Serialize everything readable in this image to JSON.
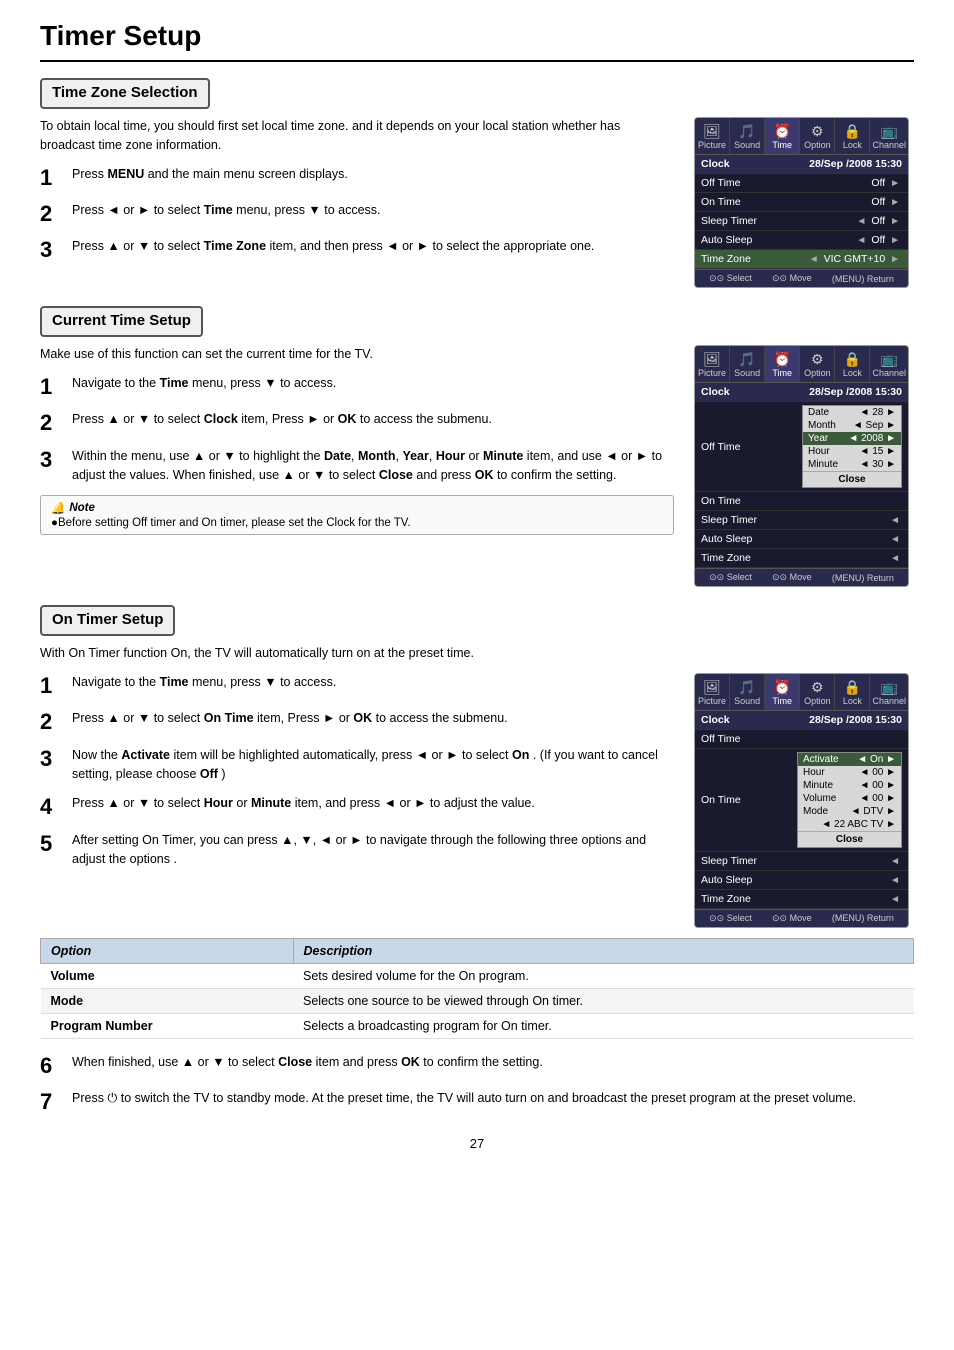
{
  "page": {
    "title": "Timer Setup",
    "page_number": "27"
  },
  "sections": {
    "timezone": {
      "heading": "Time Zone Selection",
      "description": "To obtain local time, you should first set local time zone. and it depends on your local station whether has broadcast time zone information.",
      "steps": [
        {
          "num": "1",
          "text": "Press <b>MENU</b> and the main menu screen displays."
        },
        {
          "num": "2",
          "text": "Press ◄ or ► to select <b>Time</b> menu,  press ▼  to access."
        },
        {
          "num": "3",
          "text": "Press ▲ or ▼  to select <b>Time Zone</b> item, and then press ◄ or ► to select the appropriate one."
        }
      ]
    },
    "current_time": {
      "heading": "Current Time Setup",
      "description": "Make use of this function can set the current time for the TV.",
      "steps": [
        {
          "num": "1",
          "text": "Navigate to the <b>Time</b> menu,  press ▼  to access."
        },
        {
          "num": "2",
          "text": "Press ▲ or ▼  to select <b>Clock</b> item, Press ► or  <b>OK</b> to access the submenu."
        },
        {
          "num": "3",
          "text": "Within the menu, use ▲ or ▼ to highlight the <b>Date</b>, <b>Month</b>, <b>Year</b>, <b>Hour</b> or <b>Minute</b> item, and use ◄ or ► to adjust the values. When finished, use ▲ or ▼  to select <b>Close</b> and press <b>OK</b> to confirm the setting."
        }
      ],
      "note": "Before setting Off timer and On timer, please set the Clock for the TV."
    },
    "on_timer": {
      "heading": "On Timer Setup",
      "description": "With On Timer function On, the TV will automatically turn on at the preset time.",
      "steps": [
        {
          "num": "1",
          "text": "Navigate to the <b>Time</b> menu,  press ▼  to access."
        },
        {
          "num": "2",
          "text": "Press ▲ or ▼  to select <b>On Time</b> item, Press ► or <b>OK</b> to access the submenu."
        },
        {
          "num": "3",
          "text": "Now the <b>Activate</b> item will be highlighted automatically, press ◄ or ► to select <b>On</b> . (If you want to cancel setting, please choose <b>Off</b> )"
        },
        {
          "num": "4",
          "text": "Press ▲ or ▼  to select <b>Hour</b> or <b>Minute</b> item, and press ◄ or ► to adjust the value."
        },
        {
          "num": "5",
          "text": "After setting On Timer, you can press ▲, ▼, ◄ or ► to navigate through the following three options and adjust the options ."
        }
      ],
      "options_table": {
        "headers": [
          "Option",
          "Description"
        ],
        "rows": [
          [
            "Volume",
            "Sets desired volume for the On program."
          ],
          [
            "Mode",
            "Selects one source to be viewed through On timer."
          ],
          [
            "Program Number",
            "Selects a broadcasting program for On timer."
          ]
        ]
      },
      "steps_after": [
        {
          "num": "6",
          "text": "When finished, use ▲ or ▼  to select <b>Close</b> item and press <b>OK</b> to confirm the setting."
        },
        {
          "num": "7",
          "text": "Press ⏻ to switch the TV to standby mode. At the preset time, the TV will auto turn on and broadcast the preset program at the preset volume."
        }
      ]
    }
  },
  "ui_menu_1": {
    "icons": [
      "Picture",
      "Sound",
      "Time",
      "Option",
      "Lock",
      "Channel"
    ],
    "active_icon": "Time",
    "rows": [
      {
        "label": "Clock",
        "value": "28/Sep /2008 15:30",
        "arrow_left": false,
        "arrow_right": false
      },
      {
        "label": "Off Time",
        "value": "Off",
        "arrow_left": false,
        "arrow_right": true
      },
      {
        "label": "On Time",
        "value": "Off",
        "arrow_left": false,
        "arrow_right": true
      },
      {
        "label": "Sleep Timer",
        "value": "Off",
        "arrow_left": true,
        "arrow_right": true
      },
      {
        "label": "Auto Sleep",
        "value": "Off",
        "arrow_left": true,
        "arrow_right": true
      },
      {
        "label": "Time Zone",
        "value": "VIC GMT+10",
        "arrow_left": true,
        "arrow_right": true
      }
    ],
    "footer": [
      "⊙⊙ Select",
      "⊙⊙ Move",
      "(MENU) Return"
    ]
  },
  "ui_menu_2": {
    "icons": [
      "Picture",
      "Sound",
      "Time",
      "Option",
      "Lock",
      "Channel"
    ],
    "active_icon": "Time",
    "rows": [
      {
        "label": "Clock",
        "value": "28/Sep /2008 15:30"
      },
      {
        "label": "Off Time",
        "value": ""
      },
      {
        "label": "On Time",
        "value": ""
      },
      {
        "label": "Sleep Timer",
        "value": "",
        "arrow_left": true
      },
      {
        "label": "Auto Sleep",
        "value": "",
        "arrow_left": true
      },
      {
        "label": "Time Zone",
        "value": "",
        "arrow_left": true
      }
    ],
    "popup": [
      {
        "label": "Date",
        "arrow_left": true,
        "value": "28",
        "arrow_right": true
      },
      {
        "label": "Month",
        "arrow_left": true,
        "value": "Sep",
        "arrow_right": true
      },
      {
        "label": "Year",
        "arrow_left": true,
        "value": "2008",
        "arrow_right": true
      },
      {
        "label": "Hour",
        "arrow_left": true,
        "value": "15",
        "arrow_right": true
      },
      {
        "label": "Minute",
        "arrow_left": true,
        "value": "30",
        "arrow_right": true
      }
    ],
    "popup_close": "Close",
    "footer": [
      "⊙⊙ Select",
      "⊙⊙ Move",
      "(MENU) Return"
    ]
  },
  "ui_menu_3": {
    "icons": [
      "Picture",
      "Sound",
      "Time",
      "Option",
      "Lock",
      "Channel"
    ],
    "active_icon": "Time",
    "rows": [
      {
        "label": "Clock",
        "value": "28/Sep /2008 15:30"
      },
      {
        "label": "Off Time",
        "value": ""
      },
      {
        "label": "On Time",
        "value": ""
      },
      {
        "label": "Sleep Timer",
        "value": "",
        "arrow_left": true
      },
      {
        "label": "Auto Sleep",
        "value": "",
        "arrow_left": true
      },
      {
        "label": "Time Zone",
        "value": "",
        "arrow_left": true
      }
    ],
    "popup": [
      {
        "label": "Activate",
        "arrow_left": true,
        "value": "On",
        "arrow_right": true
      },
      {
        "label": "Hour",
        "arrow_left": true,
        "value": "00",
        "arrow_right": true
      },
      {
        "label": "Minute",
        "arrow_left": true,
        "value": "00",
        "arrow_right": true
      },
      {
        "label": "Volume",
        "arrow_left": true,
        "value": "00",
        "arrow_right": true
      },
      {
        "label": "Mode",
        "arrow_left": true,
        "value": "DTV",
        "arrow_right": true
      },
      {
        "label": "",
        "arrow_left": true,
        "value": "22 ABC TV",
        "arrow_right": true
      }
    ],
    "popup_close": "Close",
    "footer": [
      "⊙⊙ Select",
      "⊙⊙ Move",
      "(MENU) Return"
    ]
  },
  "icon_symbols": {
    "Picture": "🖼",
    "Sound": "🎵",
    "Time": "⏰",
    "Option": "⚙",
    "Lock": "🔒",
    "Channel": "📺"
  }
}
